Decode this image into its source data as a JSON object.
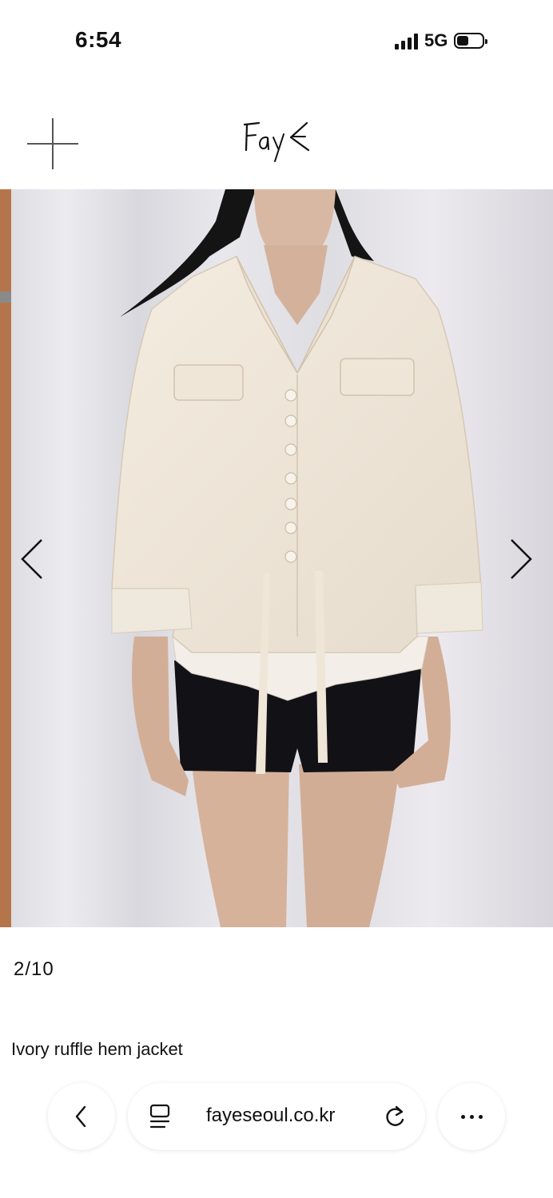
{
  "status_bar": {
    "time": "6:54",
    "network": "5G"
  },
  "header": {
    "menu_icon": "plus-icon",
    "logo_text": "FayE"
  },
  "gallery": {
    "image_alt": "Ivory ruffle hem jacket",
    "prev_icon": "chevron-left-icon",
    "next_icon": "chevron-right-icon",
    "counter": "2/10"
  },
  "product": {
    "title": "Ivory ruffle hem jacket"
  },
  "browser": {
    "url": "fayeseoul.co.kr",
    "back_icon": "chevron-left-icon",
    "reader_icon": "reader-icon",
    "reload_icon": "reload-icon",
    "more_icon": "ellipsis-icon"
  }
}
